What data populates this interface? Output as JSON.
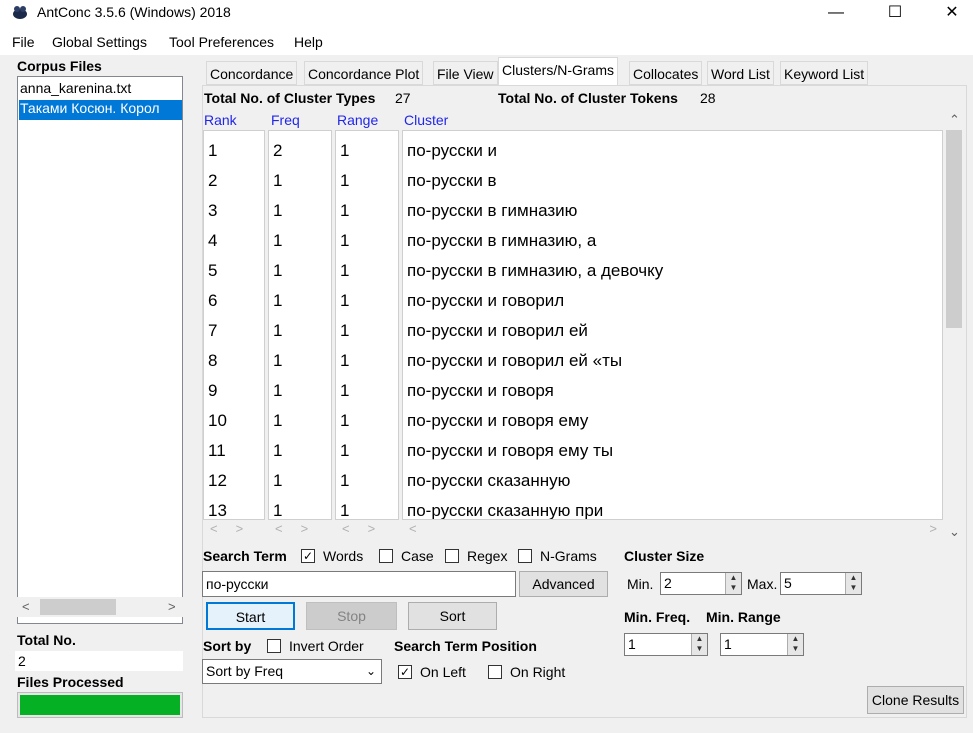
{
  "window": {
    "title": "AntConc 3.5.6 (Windows) 2018",
    "minimize": "—",
    "maximize": "☐",
    "close": "✕"
  },
  "menu": [
    "File",
    "Global Settings",
    "Tool Preferences",
    "Help"
  ],
  "left": {
    "corpus_files_label": "Corpus Files",
    "files": [
      "anna_karenina.txt",
      "Таками Косюн. Корол"
    ],
    "total_no_label": "Total No.",
    "total_no_value": "2",
    "files_processed_label": "Files Processed",
    "progress": 1.0
  },
  "tabs": [
    "Concordance",
    "Concordance Plot",
    "File View",
    "Clusters/N-Grams",
    "Collocates",
    "Word List",
    "Keyword List"
  ],
  "active_tab": "Clusters/N-Grams",
  "summary": {
    "types_label": "Total No. of Cluster Types",
    "types_value": "27",
    "tokens_label": "Total No. of Cluster Tokens",
    "tokens_value": "28"
  },
  "columns": [
    "Rank",
    "Freq",
    "Range",
    "Cluster"
  ],
  "rows": [
    [
      "1",
      "2",
      "1",
      "по-русски и"
    ],
    [
      "2",
      "1",
      "1",
      "по-русски в"
    ],
    [
      "3",
      "1",
      "1",
      "по-русски в гимназию"
    ],
    [
      "4",
      "1",
      "1",
      "по-русски в гимназию, а"
    ],
    [
      "5",
      "1",
      "1",
      "по-русски в гимназию, а девочку"
    ],
    [
      "6",
      "1",
      "1",
      "по-русски и говорил"
    ],
    [
      "7",
      "1",
      "1",
      "по-русски и говорил ей"
    ],
    [
      "8",
      "1",
      "1",
      "по-русски и говорил ей «ты"
    ],
    [
      "9",
      "1",
      "1",
      "по-русски и говоря"
    ],
    [
      "10",
      "1",
      "1",
      "по-русски и говоря ему"
    ],
    [
      "11",
      "1",
      "1",
      "по-русски и говоря ему ты"
    ],
    [
      "12",
      "1",
      "1",
      "по-русски сказанную"
    ],
    [
      "13",
      "1",
      "1",
      "по-русски сказанную при"
    ]
  ],
  "search": {
    "label": "Search Term",
    "words_label": "Words",
    "words_checked": true,
    "case_label": "Case",
    "case_checked": false,
    "regex_label": "Regex",
    "regex_checked": false,
    "ngrams_label": "N-Grams",
    "ngrams_checked": false,
    "value": "по-русски",
    "advanced_label": "Advanced"
  },
  "buttons": {
    "start": "Start",
    "stop": "Stop",
    "sort": "Sort",
    "clone": "Clone Results"
  },
  "cluster_size": {
    "label": "Cluster Size",
    "min_label": "Min.",
    "min_value": "2",
    "max_label": "Max.",
    "max_value": "5"
  },
  "min_freq": {
    "label": "Min. Freq.",
    "value": "1"
  },
  "min_range": {
    "label": "Min. Range",
    "value": "1"
  },
  "sort": {
    "label": "Sort by",
    "invert_label": "Invert Order",
    "invert_checked": false,
    "selected": "Sort by Freq"
  },
  "position": {
    "label": "Search Term Position",
    "left_label": "On Left",
    "left_checked": true,
    "right_label": "On Right",
    "right_checked": false
  },
  "colors": {
    "selection": "#0078d7",
    "column_header": "#2026e8",
    "progress": "#06b025"
  }
}
